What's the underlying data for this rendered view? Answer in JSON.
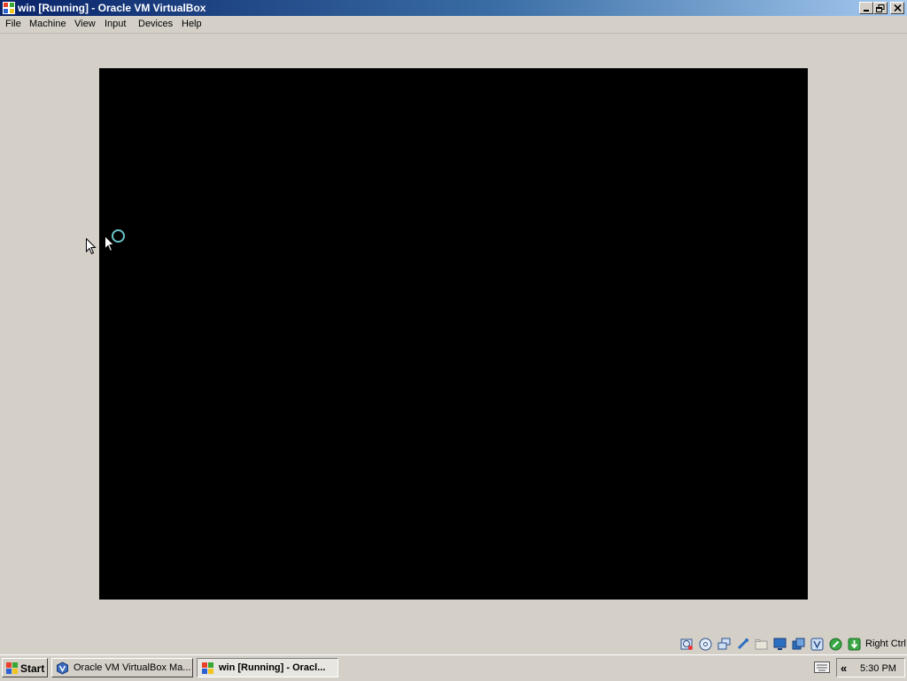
{
  "window": {
    "title": "win [Running] - Oracle VM VirtualBox"
  },
  "menu": [
    "File",
    "Machine",
    "View",
    "Input",
    "Devices",
    "Help"
  ],
  "statusbar": {
    "icons": [
      "harddisk-icon",
      "optical-disk-icon",
      "network-icon",
      "usb-icon",
      "shared-folders-icon",
      "display-icon",
      "video-capture-icon",
      "virtualization-icon",
      "mouse-integration-icon",
      "host-key-icon"
    ],
    "host_key": "Right Ctrl"
  },
  "taskbar": {
    "start_label": "Start",
    "tasks": [
      {
        "label": "Oracle VM VirtualBox Ma...",
        "icon": "virtualbox-icon",
        "active": false
      },
      {
        "label": "win [Running] - Oracl...",
        "icon": "vm-window-icon",
        "active": true
      }
    ],
    "tray_expand": "«",
    "clock": "5:30 PM"
  },
  "colors": {
    "titlebar_start": "#0a246a",
    "titlebar_end": "#a6caf0",
    "vm_screen": "#000000",
    "face": "#d4d0c8",
    "busy_ring": "#69c3c8"
  }
}
